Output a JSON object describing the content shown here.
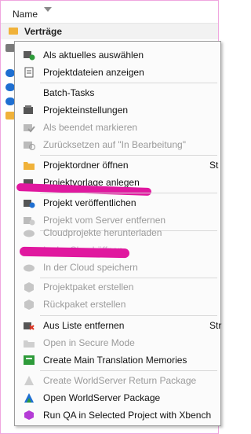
{
  "header": {
    "column_name": "Name"
  },
  "group": {
    "label": "Verträge"
  },
  "menu": {
    "items": [
      {
        "label": "Als aktuelles auswählen",
        "disabled": false,
        "icon": "set-current-icon"
      },
      {
        "label": "Projektdateien anzeigen",
        "disabled": false,
        "icon": "project-files-icon"
      },
      {
        "label": "Batch-Tasks",
        "disabled": false,
        "icon": "none"
      },
      {
        "label": "Projekteinstellungen",
        "disabled": false,
        "icon": "project-settings-icon"
      },
      {
        "label": "Als beendet markieren",
        "disabled": true,
        "icon": "mark-complete-icon"
      },
      {
        "label": "Zurücksetzen auf \"In Bearbeitung\"",
        "disabled": true,
        "icon": "revert-icon"
      },
      {
        "label": "Projektordner öffnen",
        "disabled": false,
        "icon": "folder-icon",
        "shortcut": "St"
      },
      {
        "label": "Projektvorlage anlegen",
        "disabled": false,
        "icon": "template-icon"
      },
      {
        "label": "Projekt veröffentlichen",
        "disabled": false,
        "icon": "publish-icon"
      },
      {
        "label": "Projekt vom Server entfernen",
        "disabled": true,
        "icon": "server-remove-icon"
      },
      {
        "label": "Cloudprojekte herunterladen",
        "disabled": true,
        "icon": "cloud-download-icon"
      },
      {
        "label": "In der Cloud öffnen",
        "disabled": true,
        "icon": "cloud-open-icon"
      },
      {
        "label": "In der Cloud speichern",
        "disabled": true,
        "icon": "cloud-save-icon"
      },
      {
        "label": "Projektpaket erstellen",
        "disabled": true,
        "icon": "package-icon"
      },
      {
        "label": "Rückpaket erstellen",
        "disabled": true,
        "icon": "return-package-icon"
      },
      {
        "label": "Aus Liste entfernen",
        "disabled": false,
        "icon": "remove-icon",
        "shortcut": "Str"
      },
      {
        "label": "Open in Secure Mode",
        "disabled": true,
        "icon": "secure-mode-icon"
      },
      {
        "label": "Create Main Translation Memories",
        "disabled": false,
        "icon": "tm-icon"
      },
      {
        "label": "Create WorldServer Return Package",
        "disabled": true,
        "icon": "ws-return-icon"
      },
      {
        "label": "Open WorldServer Package",
        "disabled": false,
        "icon": "ws-open-icon"
      },
      {
        "label": "Run QA in Selected Project with Xbench",
        "disabled": false,
        "icon": "xbench-icon"
      }
    ]
  },
  "colors": {
    "highlight": "#e0189f",
    "accent_green": "#2e9b3a",
    "accent_blue": "#1f6fd1",
    "folder": "#f0b23a"
  }
}
